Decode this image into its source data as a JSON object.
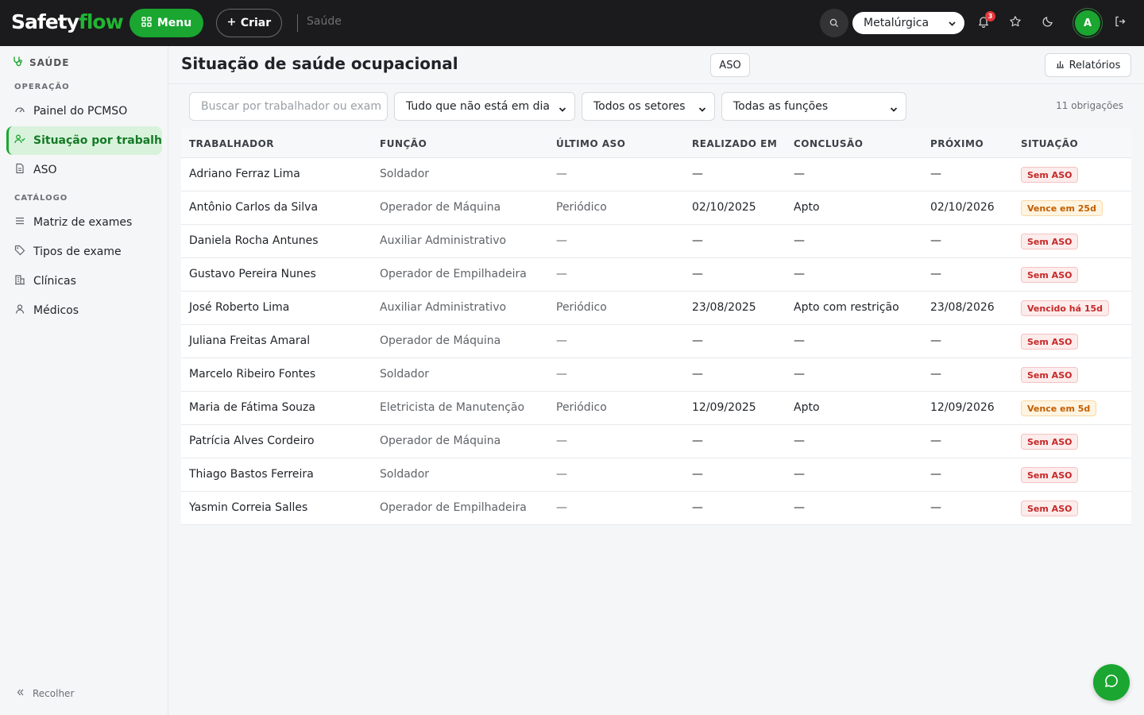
{
  "brand": {
    "part1": "Safety",
    "part2": "flow"
  },
  "topbar": {
    "menu_label": "Menu",
    "create_label": "Criar",
    "breadcrumb": "Saúde",
    "company": "Metalúrgica",
    "notifications_count": "3",
    "avatar_initial": "A"
  },
  "sidebar": {
    "section": "SAÚDE",
    "group_operation": "OPERAÇÃO",
    "group_catalog": "CATÁLOGO",
    "items": [
      {
        "label": "Painel do PCMSO",
        "icon": "gauge-icon"
      },
      {
        "label": "Situação por trabalhador",
        "icon": "users-icon"
      },
      {
        "label": "ASO",
        "icon": "document-icon"
      },
      {
        "label": "Matriz de exames",
        "icon": "list-icon"
      },
      {
        "label": "Tipos de exame",
        "icon": "tag-icon"
      },
      {
        "label": "Clínicas",
        "icon": "building-icon"
      },
      {
        "label": "Médicos",
        "icon": "user-icon"
      }
    ],
    "collapse_label": "Recolher"
  },
  "page": {
    "title": "Situação de saúde ocupacional",
    "aso_button": "ASO",
    "reports_button": "Relatórios"
  },
  "filters": {
    "search_placeholder": "Buscar por trabalhador ou exam",
    "status": "Tudo que não está em dia",
    "sector": "Todos os setores",
    "function": "Todas as funções",
    "count_label": "11 obrigações"
  },
  "table": {
    "headers": [
      "TRABALHADOR",
      "FUNÇÃO",
      "ÚLTIMO ASO",
      "REALIZADO EM",
      "CONCLUSÃO",
      "PRÓXIMO",
      "SITUAÇÃO"
    ],
    "rows": [
      {
        "worker": "Adriano Ferraz Lima",
        "function": "Soldador",
        "last": "—",
        "done": "—",
        "conclusion": "—",
        "next": "—",
        "status": "Sem ASO",
        "tone": "red"
      },
      {
        "worker": "Antônio Carlos da Silva",
        "function": "Operador de Máquina",
        "last": "Periódico",
        "done": "02/10/2025",
        "conclusion": "Apto",
        "next": "02/10/2026",
        "status": "Vence em 25d",
        "tone": "amber"
      },
      {
        "worker": "Daniela Rocha Antunes",
        "function": "Auxiliar Administrativo",
        "last": "—",
        "done": "—",
        "conclusion": "—",
        "next": "—",
        "status": "Sem ASO",
        "tone": "red"
      },
      {
        "worker": "Gustavo Pereira Nunes",
        "function": "Operador de Empilhadeira",
        "last": "—",
        "done": "—",
        "conclusion": "—",
        "next": "—",
        "status": "Sem ASO",
        "tone": "red"
      },
      {
        "worker": "José Roberto Lima",
        "function": "Auxiliar Administrativo",
        "last": "Periódico",
        "done": "23/08/2025",
        "conclusion": "Apto com restrição",
        "next": "23/08/2026",
        "status": "Vencido há 15d",
        "tone": "red"
      },
      {
        "worker": "Juliana Freitas Amaral",
        "function": "Operador de Máquina",
        "last": "—",
        "done": "—",
        "conclusion": "—",
        "next": "—",
        "status": "Sem ASO",
        "tone": "red"
      },
      {
        "worker": "Marcelo Ribeiro Fontes",
        "function": "Soldador",
        "last": "—",
        "done": "—",
        "conclusion": "—",
        "next": "—",
        "status": "Sem ASO",
        "tone": "red"
      },
      {
        "worker": "Maria de Fátima Souza",
        "function": "Eletricista de Manutenção",
        "last": "Periódico",
        "done": "12/09/2025",
        "conclusion": "Apto",
        "next": "12/09/2026",
        "status": "Vence em 5d",
        "tone": "amber"
      },
      {
        "worker": "Patrícia Alves Cordeiro",
        "function": "Operador de Máquina",
        "last": "—",
        "done": "—",
        "conclusion": "—",
        "next": "—",
        "status": "Sem ASO",
        "tone": "red"
      },
      {
        "worker": "Thiago Bastos Ferreira",
        "function": "Soldador",
        "last": "—",
        "done": "—",
        "conclusion": "—",
        "next": "—",
        "status": "Sem ASO",
        "tone": "red"
      },
      {
        "worker": "Yasmin Correia Salles",
        "function": "Operador de Empilhadeira",
        "last": "—",
        "done": "—",
        "conclusion": "—",
        "next": "—",
        "status": "Sem ASO",
        "tone": "red"
      }
    ]
  },
  "colors": {
    "brand_green": "#1aa630",
    "topbar": "#1b1b1d",
    "danger": "#c62828",
    "warning": "#c25e00"
  }
}
